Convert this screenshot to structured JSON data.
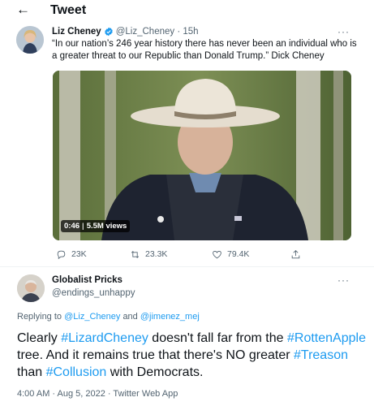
{
  "header": {
    "back_icon": "arrow-left-icon",
    "title": "Tweet"
  },
  "quoted_tweet": {
    "author_name": "Liz Cheney",
    "handle": "@Liz_Cheney",
    "separator": "·",
    "time": "15h",
    "more_icon": "···",
    "text": "“In our nation’s 246 year history there has never been an individual who is a greater threat to our Republic than Donald Trump.” Dick Cheney",
    "video": {
      "duration": "0:46",
      "views": "5.5M views"
    },
    "actions": {
      "replies": "23K",
      "retweets": "23.3K",
      "likes": "79.4K"
    }
  },
  "reply": {
    "author_name": "Globalist Pricks",
    "handle": "@endings_unhappy",
    "more_icon": "···",
    "replying_prefix": "Replying to",
    "replying_to_1": "@Liz_Cheney",
    "replying_and": "and",
    "replying_to_2": "@jimenez_mej",
    "text_parts": {
      "p1": "Clearly ",
      "h1": "#LizardCheney",
      "p2": " doesn't fall far from the ",
      "h2": "#RottenApple",
      "p3": " tree.  And it remains true that there's NO greater ",
      "h3": "#Treason",
      "p4": " than ",
      "h4": "#Collusion",
      "p5": " with Democrats."
    },
    "meta": "4:00 AM · Aug 5, 2022 · Twitter Web App"
  },
  "colors": {
    "link": "#1d9bf0",
    "secondary": "#536471",
    "text": "#0f1419"
  }
}
